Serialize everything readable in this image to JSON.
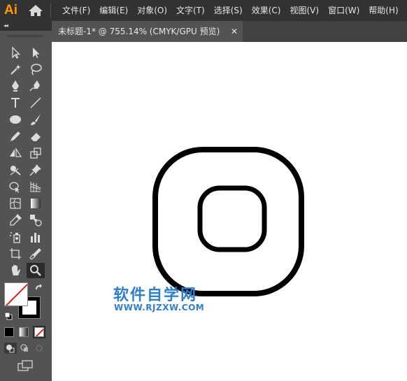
{
  "app": {
    "logo": "Ai"
  },
  "menu": [
    "文件(F)",
    "编辑(E)",
    "对象(O)",
    "文字(T)",
    "选择(S)",
    "效果(C)",
    "视图(V)",
    "窗口(W)",
    "帮助(H)"
  ],
  "document_tab": {
    "title": "未标题-1* @ 755.14% (CMYK/GPU 预览)",
    "close": "✕"
  },
  "toolbar": {
    "collapse": "◂◂"
  },
  "colors": {
    "background": "#323232",
    "panel": "#535353",
    "stroke": "#000000",
    "none_slash": "#e02020"
  },
  "watermark": {
    "name": "软件自学网",
    "url": "WWW.RJZXW.COM"
  }
}
